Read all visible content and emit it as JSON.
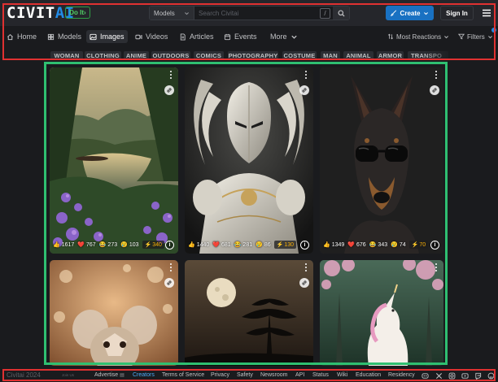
{
  "header": {
    "logo_left": "CIVIT",
    "logo_right": "AI",
    "doit_label": "Do It",
    "search_type": "Models",
    "search_placeholder": "Search Civitai",
    "search_shortcut": "/",
    "create_label": "Create",
    "signin_label": "Sign In"
  },
  "nav": {
    "items": [
      {
        "label": "Home",
        "icon": "home-icon"
      },
      {
        "label": "Models",
        "icon": "models-icon"
      },
      {
        "label": "Images",
        "icon": "images-icon",
        "active": true
      },
      {
        "label": "Videos",
        "icon": "videos-icon"
      },
      {
        "label": "Articles",
        "icon": "articles-icon"
      },
      {
        "label": "Events",
        "icon": "events-icon"
      },
      {
        "label": "More",
        "icon": "chevron-down-icon"
      }
    ],
    "sort_label": "Most Reactions",
    "filters_label": "Filters"
  },
  "tags": [
    "WOMAN",
    "CLOTHING",
    "ANIME",
    "OUTDOORS",
    "COMICS",
    "PHOTOGRAPHY",
    "COSTUME",
    "MAN",
    "ANIMAL",
    "ARMOR",
    "TRANSPO"
  ],
  "cards": [
    {
      "subject": "landscape-lake-flowers",
      "likes": "1617",
      "hearts": "767",
      "laughs": "273",
      "cries": "103",
      "buzz": "340"
    },
    {
      "subject": "armored-knight",
      "likes": "1440",
      "hearts": "681",
      "laughs": "281",
      "cries": "86",
      "buzz": "130"
    },
    {
      "subject": "doberman-sunglasses",
      "likes": "1349",
      "hearts": "676",
      "laughs": "343",
      "cries": "74",
      "buzz": "70"
    },
    {
      "subject": "crystal-mouse"
    },
    {
      "subject": "moon-tree"
    },
    {
      "subject": "unicorn-forest"
    }
  ],
  "footer": {
    "copyright": "Civitai 2024",
    "version": "Join Us",
    "links": [
      "Advertise",
      "Creators",
      "Terms of Service",
      "Privacy",
      "Safety",
      "Newsroom",
      "API",
      "Status",
      "Wiki",
      "Education",
      "Residency"
    ],
    "creators_color": "#4dabf7"
  },
  "colors": {
    "accent": "#228be6",
    "highlight_red": "#e03131",
    "highlight_green": "#2fbf71"
  }
}
